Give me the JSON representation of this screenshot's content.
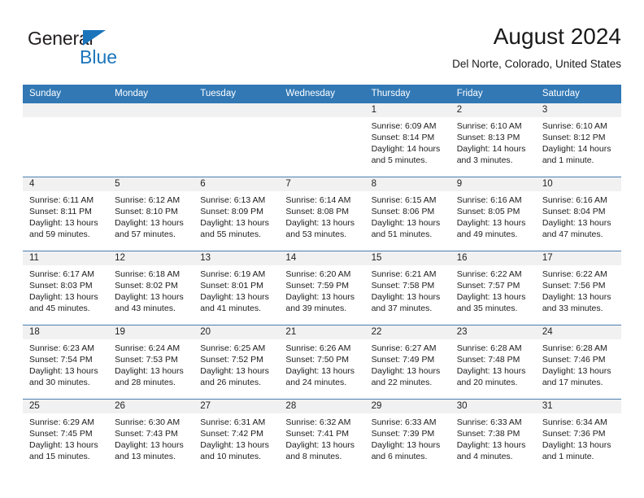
{
  "brand": {
    "word1": "General",
    "word2": "Blue",
    "triangle_color": "#1b75bb"
  },
  "header": {
    "title": "August 2024",
    "subtitle": "Del Norte, Colorado, United States"
  },
  "theme": {
    "header_blue": "#3178b5",
    "row_divider": "#4a7fb0",
    "daynum_strip": "#f1f1f1"
  },
  "weekdays": [
    "Sunday",
    "Monday",
    "Tuesday",
    "Wednesday",
    "Thursday",
    "Friday",
    "Saturday"
  ],
  "labels": {
    "sunrise_prefix": "Sunrise:",
    "sunset_prefix": "Sunset:",
    "daylight_prefix": "Daylight:"
  },
  "weeks": [
    [
      {
        "day": "",
        "sunrise": "",
        "sunset": "",
        "daylight": ""
      },
      {
        "day": "",
        "sunrise": "",
        "sunset": "",
        "daylight": ""
      },
      {
        "day": "",
        "sunrise": "",
        "sunset": "",
        "daylight": ""
      },
      {
        "day": "",
        "sunrise": "",
        "sunset": "",
        "daylight": ""
      },
      {
        "day": "1",
        "sunrise": "Sunrise: 6:09 AM",
        "sunset": "Sunset: 8:14 PM",
        "daylight": "Daylight: 14 hours and 5 minutes."
      },
      {
        "day": "2",
        "sunrise": "Sunrise: 6:10 AM",
        "sunset": "Sunset: 8:13 PM",
        "daylight": "Daylight: 14 hours and 3 minutes."
      },
      {
        "day": "3",
        "sunrise": "Sunrise: 6:10 AM",
        "sunset": "Sunset: 8:12 PM",
        "daylight": "Daylight: 14 hours and 1 minute."
      }
    ],
    [
      {
        "day": "4",
        "sunrise": "Sunrise: 6:11 AM",
        "sunset": "Sunset: 8:11 PM",
        "daylight": "Daylight: 13 hours and 59 minutes."
      },
      {
        "day": "5",
        "sunrise": "Sunrise: 6:12 AM",
        "sunset": "Sunset: 8:10 PM",
        "daylight": "Daylight: 13 hours and 57 minutes."
      },
      {
        "day": "6",
        "sunrise": "Sunrise: 6:13 AM",
        "sunset": "Sunset: 8:09 PM",
        "daylight": "Daylight: 13 hours and 55 minutes."
      },
      {
        "day": "7",
        "sunrise": "Sunrise: 6:14 AM",
        "sunset": "Sunset: 8:08 PM",
        "daylight": "Daylight: 13 hours and 53 minutes."
      },
      {
        "day": "8",
        "sunrise": "Sunrise: 6:15 AM",
        "sunset": "Sunset: 8:06 PM",
        "daylight": "Daylight: 13 hours and 51 minutes."
      },
      {
        "day": "9",
        "sunrise": "Sunrise: 6:16 AM",
        "sunset": "Sunset: 8:05 PM",
        "daylight": "Daylight: 13 hours and 49 minutes."
      },
      {
        "day": "10",
        "sunrise": "Sunrise: 6:16 AM",
        "sunset": "Sunset: 8:04 PM",
        "daylight": "Daylight: 13 hours and 47 minutes."
      }
    ],
    [
      {
        "day": "11",
        "sunrise": "Sunrise: 6:17 AM",
        "sunset": "Sunset: 8:03 PM",
        "daylight": "Daylight: 13 hours and 45 minutes."
      },
      {
        "day": "12",
        "sunrise": "Sunrise: 6:18 AM",
        "sunset": "Sunset: 8:02 PM",
        "daylight": "Daylight: 13 hours and 43 minutes."
      },
      {
        "day": "13",
        "sunrise": "Sunrise: 6:19 AM",
        "sunset": "Sunset: 8:01 PM",
        "daylight": "Daylight: 13 hours and 41 minutes."
      },
      {
        "day": "14",
        "sunrise": "Sunrise: 6:20 AM",
        "sunset": "Sunset: 7:59 PM",
        "daylight": "Daylight: 13 hours and 39 minutes."
      },
      {
        "day": "15",
        "sunrise": "Sunrise: 6:21 AM",
        "sunset": "Sunset: 7:58 PM",
        "daylight": "Daylight: 13 hours and 37 minutes."
      },
      {
        "day": "16",
        "sunrise": "Sunrise: 6:22 AM",
        "sunset": "Sunset: 7:57 PM",
        "daylight": "Daylight: 13 hours and 35 minutes."
      },
      {
        "day": "17",
        "sunrise": "Sunrise: 6:22 AM",
        "sunset": "Sunset: 7:56 PM",
        "daylight": "Daylight: 13 hours and 33 minutes."
      }
    ],
    [
      {
        "day": "18",
        "sunrise": "Sunrise: 6:23 AM",
        "sunset": "Sunset: 7:54 PM",
        "daylight": "Daylight: 13 hours and 30 minutes."
      },
      {
        "day": "19",
        "sunrise": "Sunrise: 6:24 AM",
        "sunset": "Sunset: 7:53 PM",
        "daylight": "Daylight: 13 hours and 28 minutes."
      },
      {
        "day": "20",
        "sunrise": "Sunrise: 6:25 AM",
        "sunset": "Sunset: 7:52 PM",
        "daylight": "Daylight: 13 hours and 26 minutes."
      },
      {
        "day": "21",
        "sunrise": "Sunrise: 6:26 AM",
        "sunset": "Sunset: 7:50 PM",
        "daylight": "Daylight: 13 hours and 24 minutes."
      },
      {
        "day": "22",
        "sunrise": "Sunrise: 6:27 AM",
        "sunset": "Sunset: 7:49 PM",
        "daylight": "Daylight: 13 hours and 22 minutes."
      },
      {
        "day": "23",
        "sunrise": "Sunrise: 6:28 AM",
        "sunset": "Sunset: 7:48 PM",
        "daylight": "Daylight: 13 hours and 20 minutes."
      },
      {
        "day": "24",
        "sunrise": "Sunrise: 6:28 AM",
        "sunset": "Sunset: 7:46 PM",
        "daylight": "Daylight: 13 hours and 17 minutes."
      }
    ],
    [
      {
        "day": "25",
        "sunrise": "Sunrise: 6:29 AM",
        "sunset": "Sunset: 7:45 PM",
        "daylight": "Daylight: 13 hours and 15 minutes."
      },
      {
        "day": "26",
        "sunrise": "Sunrise: 6:30 AM",
        "sunset": "Sunset: 7:43 PM",
        "daylight": "Daylight: 13 hours and 13 minutes."
      },
      {
        "day": "27",
        "sunrise": "Sunrise: 6:31 AM",
        "sunset": "Sunset: 7:42 PM",
        "daylight": "Daylight: 13 hours and 10 minutes."
      },
      {
        "day": "28",
        "sunrise": "Sunrise: 6:32 AM",
        "sunset": "Sunset: 7:41 PM",
        "daylight": "Daylight: 13 hours and 8 minutes."
      },
      {
        "day": "29",
        "sunrise": "Sunrise: 6:33 AM",
        "sunset": "Sunset: 7:39 PM",
        "daylight": "Daylight: 13 hours and 6 minutes."
      },
      {
        "day": "30",
        "sunrise": "Sunrise: 6:33 AM",
        "sunset": "Sunset: 7:38 PM",
        "daylight": "Daylight: 13 hours and 4 minutes."
      },
      {
        "day": "31",
        "sunrise": "Sunrise: 6:34 AM",
        "sunset": "Sunset: 7:36 PM",
        "daylight": "Daylight: 13 hours and 1 minute."
      }
    ]
  ]
}
